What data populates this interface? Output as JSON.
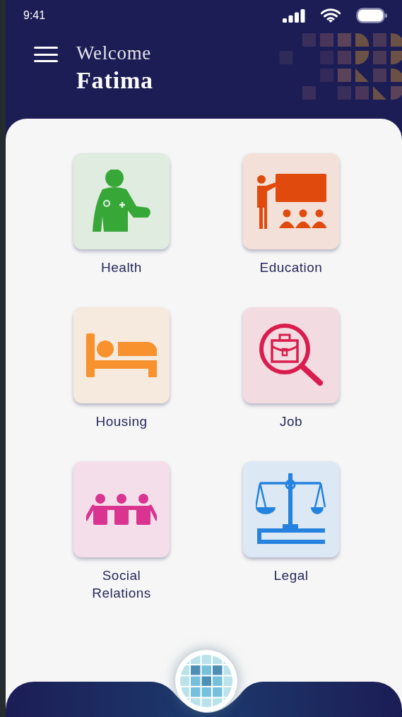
{
  "status_bar": {
    "time": "9:41"
  },
  "header": {
    "greeting": "Welcome",
    "name": "Fatima"
  },
  "categories": [
    {
      "label": "Health",
      "color": "#37a738"
    },
    {
      "label": "Education",
      "color": "#e04a0c"
    },
    {
      "label": "Housing",
      "color": "#f7922e"
    },
    {
      "label": "Job",
      "color": "#d91e4f"
    },
    {
      "label": "Social Relations",
      "color": "#da3491"
    },
    {
      "label": "Legal",
      "color": "#2583df"
    }
  ]
}
